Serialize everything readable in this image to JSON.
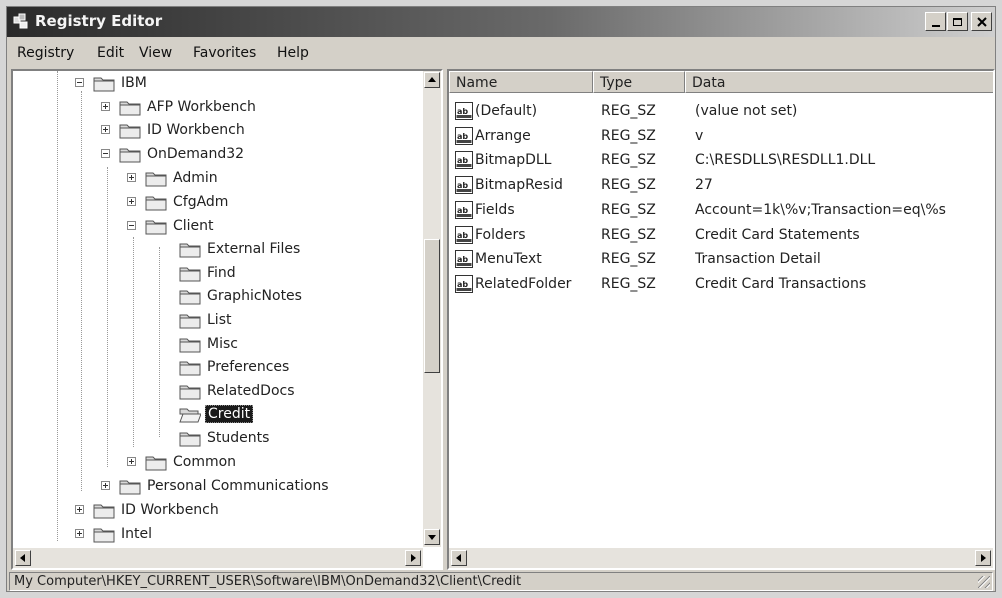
{
  "window": {
    "title": "Registry Editor"
  },
  "menu": [
    "Registry",
    "Edit",
    "View",
    "Favorites",
    "Help"
  ],
  "tree": [
    {
      "label": "IBM",
      "expanded": true
    },
    {
      "label": "AFP Workbench",
      "expanded": false
    },
    {
      "label": "ID Workbench",
      "expanded": false
    },
    {
      "label": "OnDemand32",
      "expanded": true
    },
    {
      "label": "Admin",
      "expanded": false
    },
    {
      "label": "CfgAdm",
      "expanded": false
    },
    {
      "label": "Client",
      "expanded": true
    },
    {
      "label": "External Files"
    },
    {
      "label": "Find"
    },
    {
      "label": "GraphicNotes"
    },
    {
      "label": "List"
    },
    {
      "label": "Misc"
    },
    {
      "label": "Preferences"
    },
    {
      "label": "RelatedDocs"
    },
    {
      "label": "Credit",
      "selected": true
    },
    {
      "label": "Students"
    },
    {
      "label": "Common",
      "expanded": false
    },
    {
      "label": "Personal Communications",
      "expanded": false
    },
    {
      "label": "ID Workbench",
      "expanded": false
    },
    {
      "label": "Intel",
      "expanded": false
    }
  ],
  "list": {
    "columns": [
      "Name",
      "Type",
      "Data"
    ],
    "rows": [
      {
        "name": "(Default)",
        "type": "REG_SZ",
        "data": "(value not set)"
      },
      {
        "name": "Arrange",
        "type": "REG_SZ",
        "data": "v"
      },
      {
        "name": "BitmapDLL",
        "type": "REG_SZ",
        "data": "C:\\RESDLLS\\RESDLL1.DLL"
      },
      {
        "name": "BitmapResid",
        "type": "REG_SZ",
        "data": "27"
      },
      {
        "name": "Fields",
        "type": "REG_SZ",
        "data": "Account=1k\\%v;Transaction=eq\\%s"
      },
      {
        "name": "Folders",
        "type": "REG_SZ",
        "data": "Credit Card Statements"
      },
      {
        "name": "MenuText",
        "type": "REG_SZ",
        "data": "Transaction Detail"
      },
      {
        "name": "RelatedFolder",
        "type": "REG_SZ",
        "data": "Credit Card Transactions"
      }
    ]
  },
  "status": {
    "path": "My Computer\\HKEY_CURRENT_USER\\Software\\IBM\\OnDemand32\\Client\\Credit"
  },
  "icons": {
    "app": "registry-editor-icon",
    "tree_item": "folder-icon",
    "list_item": "string-value-icon",
    "minimize": "minimize-icon",
    "maximize": "maximize-icon",
    "close": "close-icon"
  }
}
